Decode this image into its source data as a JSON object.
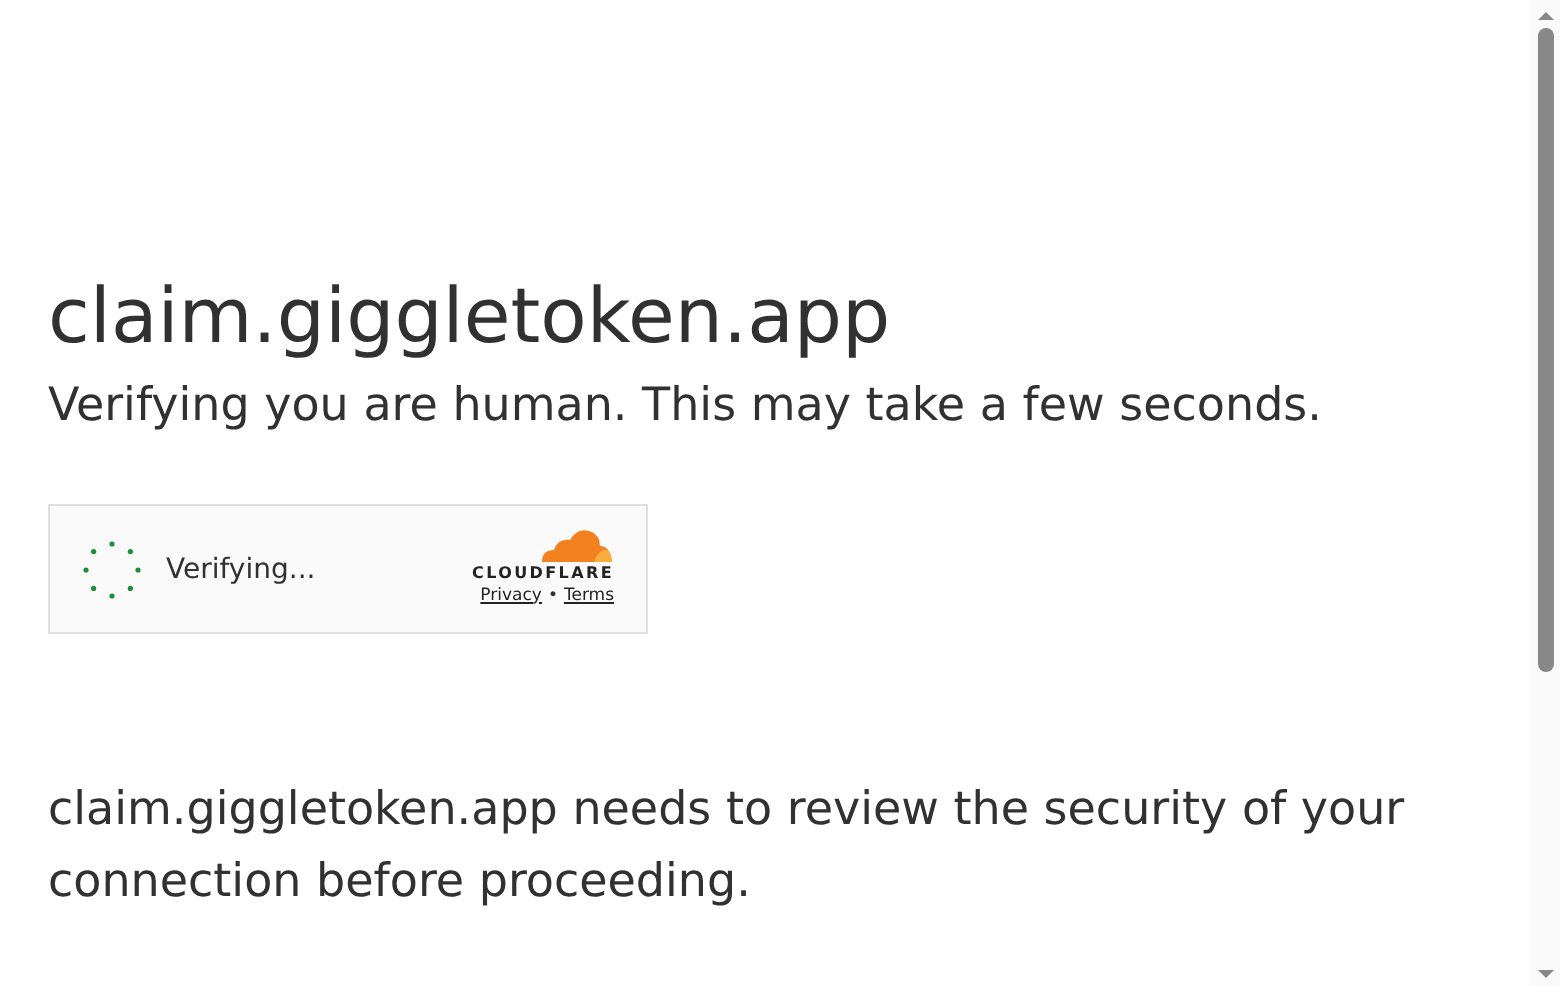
{
  "title": "claim.giggletoken.app",
  "subtitle": "Verifying you are human. This may take a few seconds.",
  "widget": {
    "status": "Verifying...",
    "brand": "CLOUDFLARE",
    "links": [
      "Privacy",
      "Terms"
    ],
    "separator": "•"
  },
  "message": "claim.giggletoken.app needs to review the security of your connection before proceeding."
}
